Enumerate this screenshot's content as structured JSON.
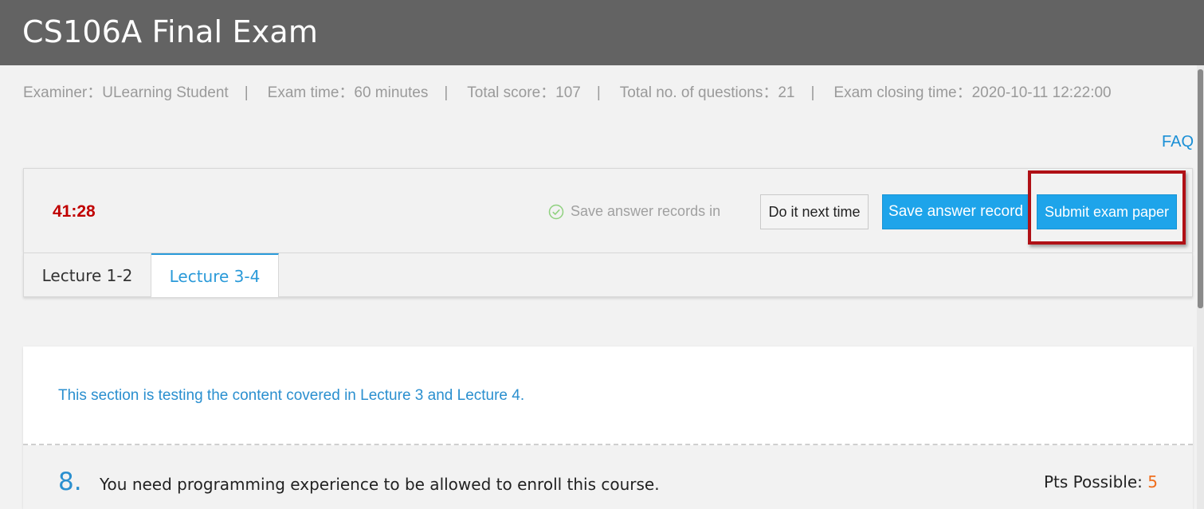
{
  "header": {
    "title": "CS106A Final Exam"
  },
  "meta": {
    "examiner": "Examiner：ULearning Student",
    "exam_time": "Exam time：60 minutes",
    "total_score": "Total score：107",
    "total_questions": "Total no. of questions：21",
    "closing_time": "Exam closing time：2020-10-11 12:22:00",
    "separator": "|"
  },
  "faq_link": "FAQ",
  "toolbar": {
    "timer": "41:28",
    "save_status": "Save answer records in",
    "do_next_time": "Do it next time",
    "save_answer": "Save answer record",
    "submit": "Submit exam paper"
  },
  "tabs": [
    {
      "label": "Lecture 1-2",
      "active": false
    },
    {
      "label": "Lecture 3-4",
      "active": true
    }
  ],
  "section": {
    "note": "This section is testing the content covered in Lecture 3 and Lecture 4."
  },
  "question": {
    "number": "8.",
    "text": "You need programming experience to be allowed to enroll this course.",
    "pts_label": "Pts Possible:",
    "pts_value": "5"
  },
  "colors": {
    "header_bg": "#636363",
    "timer": "#c00000",
    "primary_button": "#1ea4ea",
    "link": "#2a8fcf",
    "highlight": "#b01016",
    "points": "#ef6f1e"
  },
  "icons": {
    "save_status": "check-circle-icon"
  }
}
